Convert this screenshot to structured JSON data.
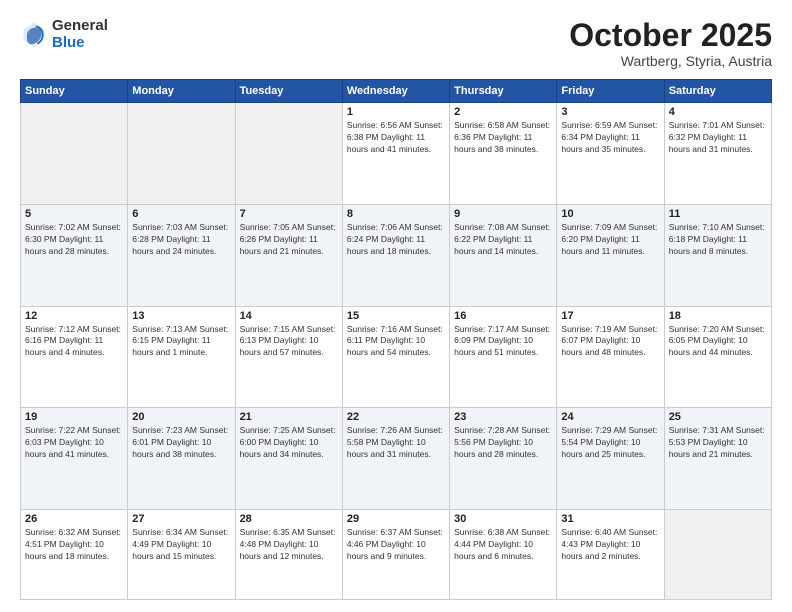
{
  "logo": {
    "general": "General",
    "blue": "Blue"
  },
  "header": {
    "month": "October 2025",
    "location": "Wartberg, Styria, Austria"
  },
  "days_of_week": [
    "Sunday",
    "Monday",
    "Tuesday",
    "Wednesday",
    "Thursday",
    "Friday",
    "Saturday"
  ],
  "weeks": [
    [
      {
        "day": "",
        "info": ""
      },
      {
        "day": "",
        "info": ""
      },
      {
        "day": "",
        "info": ""
      },
      {
        "day": "1",
        "info": "Sunrise: 6:56 AM\nSunset: 6:38 PM\nDaylight: 11 hours\nand 41 minutes."
      },
      {
        "day": "2",
        "info": "Sunrise: 6:58 AM\nSunset: 6:36 PM\nDaylight: 11 hours\nand 38 minutes."
      },
      {
        "day": "3",
        "info": "Sunrise: 6:59 AM\nSunset: 6:34 PM\nDaylight: 11 hours\nand 35 minutes."
      },
      {
        "day": "4",
        "info": "Sunrise: 7:01 AM\nSunset: 6:32 PM\nDaylight: 11 hours\nand 31 minutes."
      }
    ],
    [
      {
        "day": "5",
        "info": "Sunrise: 7:02 AM\nSunset: 6:30 PM\nDaylight: 11 hours\nand 28 minutes."
      },
      {
        "day": "6",
        "info": "Sunrise: 7:03 AM\nSunset: 6:28 PM\nDaylight: 11 hours\nand 24 minutes."
      },
      {
        "day": "7",
        "info": "Sunrise: 7:05 AM\nSunset: 6:26 PM\nDaylight: 11 hours\nand 21 minutes."
      },
      {
        "day": "8",
        "info": "Sunrise: 7:06 AM\nSunset: 6:24 PM\nDaylight: 11 hours\nand 18 minutes."
      },
      {
        "day": "9",
        "info": "Sunrise: 7:08 AM\nSunset: 6:22 PM\nDaylight: 11 hours\nand 14 minutes."
      },
      {
        "day": "10",
        "info": "Sunrise: 7:09 AM\nSunset: 6:20 PM\nDaylight: 11 hours\nand 11 minutes."
      },
      {
        "day": "11",
        "info": "Sunrise: 7:10 AM\nSunset: 6:18 PM\nDaylight: 11 hours\nand 8 minutes."
      }
    ],
    [
      {
        "day": "12",
        "info": "Sunrise: 7:12 AM\nSunset: 6:16 PM\nDaylight: 11 hours\nand 4 minutes."
      },
      {
        "day": "13",
        "info": "Sunrise: 7:13 AM\nSunset: 6:15 PM\nDaylight: 11 hours\nand 1 minute."
      },
      {
        "day": "14",
        "info": "Sunrise: 7:15 AM\nSunset: 6:13 PM\nDaylight: 10 hours\nand 57 minutes."
      },
      {
        "day": "15",
        "info": "Sunrise: 7:16 AM\nSunset: 6:11 PM\nDaylight: 10 hours\nand 54 minutes."
      },
      {
        "day": "16",
        "info": "Sunrise: 7:17 AM\nSunset: 6:09 PM\nDaylight: 10 hours\nand 51 minutes."
      },
      {
        "day": "17",
        "info": "Sunrise: 7:19 AM\nSunset: 6:07 PM\nDaylight: 10 hours\nand 48 minutes."
      },
      {
        "day": "18",
        "info": "Sunrise: 7:20 AM\nSunset: 6:05 PM\nDaylight: 10 hours\nand 44 minutes."
      }
    ],
    [
      {
        "day": "19",
        "info": "Sunrise: 7:22 AM\nSunset: 6:03 PM\nDaylight: 10 hours\nand 41 minutes."
      },
      {
        "day": "20",
        "info": "Sunrise: 7:23 AM\nSunset: 6:01 PM\nDaylight: 10 hours\nand 38 minutes."
      },
      {
        "day": "21",
        "info": "Sunrise: 7:25 AM\nSunset: 6:00 PM\nDaylight: 10 hours\nand 34 minutes."
      },
      {
        "day": "22",
        "info": "Sunrise: 7:26 AM\nSunset: 5:58 PM\nDaylight: 10 hours\nand 31 minutes."
      },
      {
        "day": "23",
        "info": "Sunrise: 7:28 AM\nSunset: 5:56 PM\nDaylight: 10 hours\nand 28 minutes."
      },
      {
        "day": "24",
        "info": "Sunrise: 7:29 AM\nSunset: 5:54 PM\nDaylight: 10 hours\nand 25 minutes."
      },
      {
        "day": "25",
        "info": "Sunrise: 7:31 AM\nSunset: 5:53 PM\nDaylight: 10 hours\nand 21 minutes."
      }
    ],
    [
      {
        "day": "26",
        "info": "Sunrise: 6:32 AM\nSunset: 4:51 PM\nDaylight: 10 hours\nand 18 minutes."
      },
      {
        "day": "27",
        "info": "Sunrise: 6:34 AM\nSunset: 4:49 PM\nDaylight: 10 hours\nand 15 minutes."
      },
      {
        "day": "28",
        "info": "Sunrise: 6:35 AM\nSunset: 4:48 PM\nDaylight: 10 hours\nand 12 minutes."
      },
      {
        "day": "29",
        "info": "Sunrise: 6:37 AM\nSunset: 4:46 PM\nDaylight: 10 hours\nand 9 minutes."
      },
      {
        "day": "30",
        "info": "Sunrise: 6:38 AM\nSunset: 4:44 PM\nDaylight: 10 hours\nand 6 minutes."
      },
      {
        "day": "31",
        "info": "Sunrise: 6:40 AM\nSunset: 4:43 PM\nDaylight: 10 hours\nand 2 minutes."
      },
      {
        "day": "",
        "info": ""
      }
    ]
  ]
}
